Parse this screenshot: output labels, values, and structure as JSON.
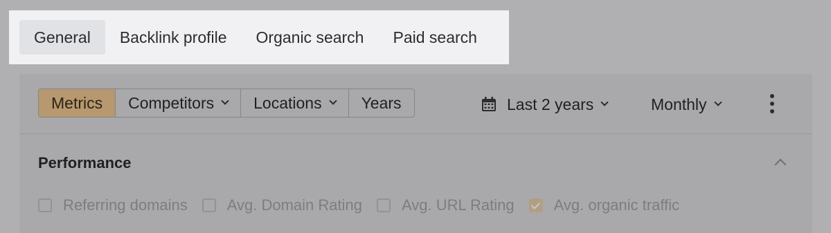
{
  "top_tabs": [
    {
      "label": "General",
      "active": true
    },
    {
      "label": "Backlink profile",
      "active": false
    },
    {
      "label": "Organic search",
      "active": false
    },
    {
      "label": "Paid search",
      "active": false
    }
  ],
  "toolbar": {
    "segments": [
      {
        "label": "Metrics",
        "active": true,
        "dropdown": false
      },
      {
        "label": "Competitors",
        "active": false,
        "dropdown": true
      },
      {
        "label": "Locations",
        "active": false,
        "dropdown": true
      },
      {
        "label": "Years",
        "active": false,
        "dropdown": false
      }
    ],
    "date_range": "Last 2 years",
    "frequency": "Monthly"
  },
  "section": {
    "title": "Performance",
    "metrics": [
      {
        "label": "Referring domains",
        "checked": false
      },
      {
        "label": "Avg. Domain Rating",
        "checked": false
      },
      {
        "label": "Avg. URL Rating",
        "checked": false
      },
      {
        "label": "Avg. organic traffic",
        "checked": true
      }
    ]
  },
  "colors": {
    "active_segment": "#b7986f",
    "checked_box": "#c08b3f",
    "highlight_strip": "#f1f1f3",
    "overlay": "#b0b0b2"
  }
}
